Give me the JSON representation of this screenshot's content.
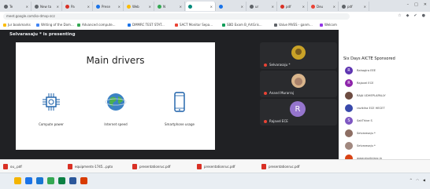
{
  "browser": {
    "tabs": [
      {
        "label": "Te",
        "icon": "#5f6368"
      },
      {
        "label": "New ta",
        "icon": "#5f6368"
      },
      {
        "label": "Pa",
        "icon": "#d93025"
      },
      {
        "label": "Prese",
        "icon": "#1a73e8"
      },
      {
        "label": "Web",
        "icon": "#fbbc04"
      },
      {
        "label": "N",
        "icon": "#34a853"
      },
      {
        "label": "",
        "icon": "#00897b"
      },
      {
        "label": "",
        "icon": "#1a73e8"
      },
      {
        "label": "ur",
        "icon": "#5f6368"
      },
      {
        "label": "pdf",
        "icon": "#d93025"
      },
      {
        "label": "Deu",
        "icon": "#ea4335"
      },
      {
        "label": "pdf",
        "icon": "#5f6368"
      }
    ],
    "url": "meet.google.com/ko-dmxp-zcz",
    "bookmarks": [
      "Jur bookmarks",
      "Writing of the Dom...",
      "Advanced compute...",
      "DMMRC TEST STAT...",
      "SACT Monitor Sepa...",
      "SBD Exam B_ArtGris...",
      "Value MVES - ganm...",
      "Welcom"
    ]
  },
  "meet": {
    "presenter": "Selvarasaju * is presenting",
    "slide": {
      "title": "Main drivers",
      "features": [
        {
          "label": "Compute power",
          "icon": "chip-icon"
        },
        {
          "label": "Internet speed",
          "icon": "globe-icon"
        },
        {
          "label": "Smartphone usage",
          "icon": "smartphone-icon"
        }
      ]
    },
    "tiles": [
      {
        "name": "Selvarasaju *",
        "avatar": ""
      },
      {
        "name": "Anand Murarraj",
        "avatar": ""
      },
      {
        "name": "Rajavel ECE",
        "avatar": "R"
      }
    ]
  },
  "sidebar": {
    "title": "Six Days AICTE Sponsored",
    "participants": [
      {
        "name": "Rahaglra EEE",
        "initial": "R",
        "color": "#5e35b1"
      },
      {
        "name": "Rajavel ECE",
        "initial": "R",
        "color": "#8e24aa"
      },
      {
        "name": "RAJA UDHEPLAPALLY",
        "initial": "",
        "color": "#6d4c41"
      },
      {
        "name": "ravikiha ECE HECET",
        "initial": "",
        "color": "#3949ab"
      },
      {
        "name": "SakThive S",
        "initial": "S",
        "color": "#7e57c2"
      },
      {
        "name": "Selvarasaju *",
        "initial": "",
        "color": "#8d6e63"
      },
      {
        "name": "Selvarasaju *",
        "initial": "",
        "color": "#a1887f"
      },
      {
        "name": "www.studiclanc.in",
        "initial": "",
        "color": "#d84315"
      },
      {
        "name": "VELMANTA",
        "initial": "V",
        "color": "#1e88e5"
      }
    ]
  },
  "downloads": [
    "ou_.pdf",
    "equipments-1745...pptx",
    "presentationruc.pdf",
    "presentationruc.pdf",
    "presentationruc.pdf"
  ],
  "taskbar": {
    "icons": [
      "#f4b400",
      "#1a73e8",
      "#1976d2",
      "#34a853",
      "#0b8043",
      "#2b579a",
      "#d83b01"
    ]
  }
}
